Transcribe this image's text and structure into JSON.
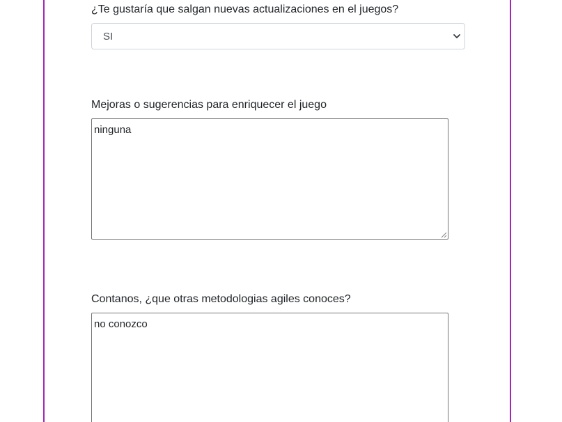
{
  "form": {
    "question_updates": {
      "label": "¿Te gustaría que salgan nuevas actualizaciones en el juegos?",
      "selected_value": "SI"
    },
    "question_improvements": {
      "label": "Mejoras o sugerencias para enriquecer el juego",
      "value": "ninguna"
    },
    "question_methodologies": {
      "label": "Contanos, ¿que otras metodologias agiles conoces?",
      "value": "no conozco"
    }
  },
  "colors": {
    "card_border": "#a526b6",
    "input_border": "#ced4da",
    "textarea_border": "#767676"
  },
  "icons": {
    "select_arrow": "chevron-down-icon",
    "resize": "resize-grip-icon"
  }
}
